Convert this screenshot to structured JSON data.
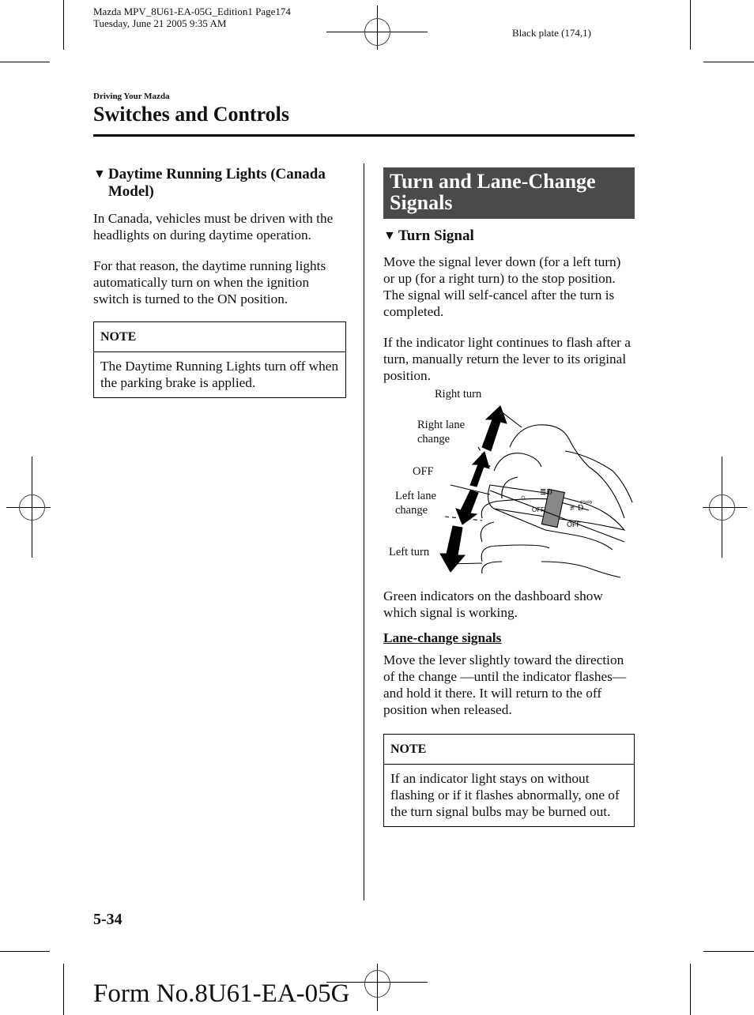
{
  "print_header": {
    "meta_line1": "Mazda MPV_8U61-EA-05G_Edition1 Page174",
    "meta_line2": "Tuesday, June 21 2005 9:35 AM",
    "plate": "Black plate (174,1)"
  },
  "breadcrumb": "Driving Your Mazda",
  "page_title": "Switches and Controls",
  "left_column": {
    "heading_marker": "▼",
    "heading": "Daytime Running Lights (Canada Model)",
    "paragraphs": [
      "In Canada, vehicles must be driven with the headlights on during daytime operation.",
      "For that reason, the daytime running lights automatically turn on when the ignition switch is turned to the ON position."
    ],
    "note": {
      "title": "NOTE",
      "body": "The Daytime Running Lights turn off when the parking brake is applied."
    }
  },
  "right_column": {
    "section_title": "Turn and Lane-Change Signals",
    "heading_marker": "▼",
    "heading": "Turn Signal",
    "paragraphs": [
      "Move the signal lever down (for a left turn) or up (for a right turn) to the stop position. The signal will self-cancel after the turn is completed.",
      "If the indicator light continues to flash after a turn, manually return the lever to its original position."
    ],
    "figure": {
      "labels": {
        "right_turn": "Right turn",
        "right_lane_change_1": "Right lane",
        "right_lane_change_2": "change",
        "off": "OFF",
        "left_lane_change_1": "Left lane",
        "left_lane_change_2": "change",
        "left_turn": "Left turn"
      },
      "lever_text": {
        "off_inner": "OFF",
        "off_outer": "OFF"
      }
    },
    "after_figure": "Green indicators on the dashboard show which signal is working.",
    "subsection_title": "Lane-change signals",
    "subsection_body": "Move the lever slightly toward the direction of the change —until the indicator flashes— and hold it there. It will return to the off position when released.",
    "note": {
      "title": "NOTE",
      "body": "If an indicator light stays on without flashing or if it flashes abnormally, one of the turn signal bulbs may be burned out."
    }
  },
  "page_number": "5-34",
  "form_number": "Form No.8U61-EA-05G"
}
